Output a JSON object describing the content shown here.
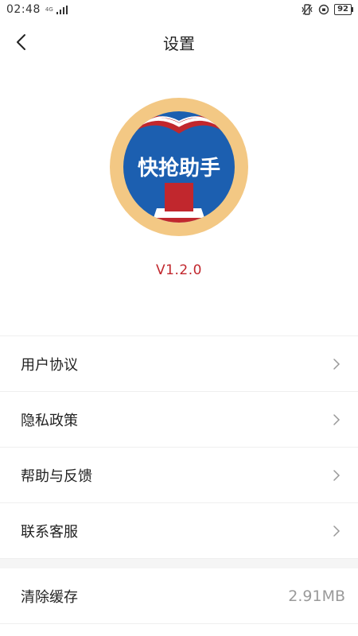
{
  "status_bar": {
    "time": "02:48",
    "network": "4G",
    "battery": "92"
  },
  "header": {
    "title": "设置"
  },
  "logo": {
    "text": "快抢助手"
  },
  "version": "V1.2.0",
  "menu": {
    "items": [
      {
        "label": "用户协议"
      },
      {
        "label": "隐私政策"
      },
      {
        "label": "帮助与反馈"
      },
      {
        "label": "联系客服"
      }
    ]
  },
  "cache": {
    "label": "清除缓存",
    "size": "2.91MB"
  },
  "colors": {
    "accent": "#c1272d",
    "logo_blue": "#1c5fb0",
    "logo_ring": "#f3c884"
  }
}
